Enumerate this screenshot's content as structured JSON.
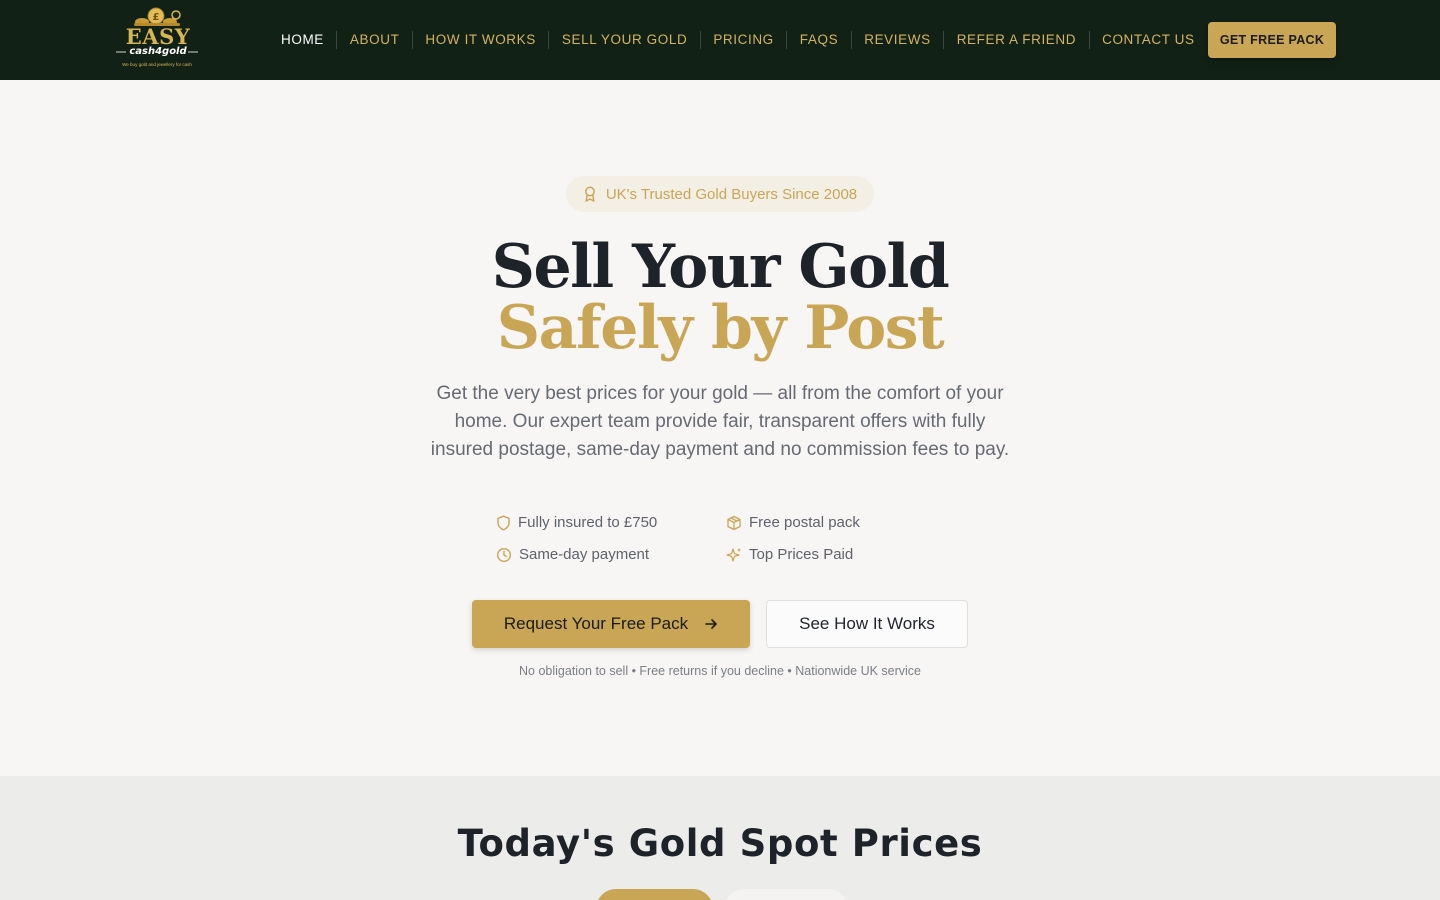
{
  "header": {
    "logo": {
      "top": "EASY",
      "sub": "cash4gold",
      "tagline": "We buy gold and jewellery for cash"
    },
    "nav": [
      "HOME",
      "ABOUT",
      "HOW IT WORKS",
      "SELL YOUR GOLD",
      "PRICING",
      "FAQS",
      "REVIEWS",
      "REFER A FRIEND",
      "CONTACT US"
    ],
    "cta_label": "GET FREE PACK"
  },
  "hero": {
    "badge_icon": "award-icon",
    "badge": "UK's Trusted Gold Buyers Since 2008",
    "title_line1": "Sell Your Gold",
    "title_line2": "Safely by Post",
    "lede": "Get the very best prices for your gold — all from the comfort of your home. Our expert team provide fair, transparent offers with fully insured postage, same-day payment and no commission fees to pay.",
    "features": [
      {
        "icon": "shield-icon",
        "label": "Fully insured to £750"
      },
      {
        "icon": "package-icon",
        "label": "Free postal pack"
      },
      {
        "icon": "clock-icon",
        "label": "Same-day payment"
      },
      {
        "icon": "sparkles-icon",
        "label": "Top Prices Paid"
      }
    ],
    "primary_cta": "Request Your Free Pack",
    "primary_cta_icon": "arrow-right-icon",
    "secondary_cta": "See How It Works",
    "note": "No obligation to sell • Free returns if you decline • Nationwide UK service"
  },
  "spot_prices": {
    "title": "Today's Gold Spot Prices"
  },
  "colors": {
    "header_bg": "#112116",
    "gold_accent": "#c9a656",
    "page_bg": "#f7f6f4",
    "section_bg": "#ececea",
    "heading_dark": "#1e2229"
  }
}
